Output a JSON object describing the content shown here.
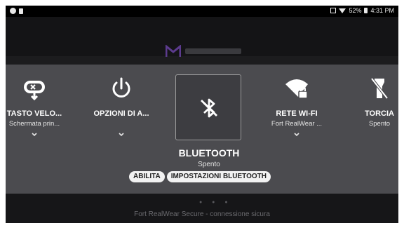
{
  "status_bar": {
    "battery_percent": "52%",
    "time": "4:31 PM"
  },
  "background": {
    "footer_text": "Fort RealWear Secure - connessione sicura"
  },
  "tiles": [
    {
      "title": "TASTO VELO...",
      "subtitle": "Schermata prin...",
      "icon": "controller-icon"
    },
    {
      "title": "OPZIONI DI A...",
      "subtitle": "",
      "icon": "power-icon"
    },
    {
      "title": "RETE WI-FI",
      "subtitle": "Fort RealWear ...",
      "icon": "wifi-lock-icon"
    },
    {
      "title": "TORCIA",
      "subtitle": "Spento",
      "icon": "flashlight-off-icon"
    }
  ],
  "bluetooth": {
    "icon": "bluetooth-off-icon",
    "title": "BLUETOOTH",
    "subtitle": "Spento",
    "actions": [
      "ABILITA",
      "IMPOSTAZIONI BLUETOOTH"
    ]
  },
  "colors": {
    "overlay": "#4b4b4f",
    "background": "#1c1c1e",
    "text": "#ffffff"
  }
}
